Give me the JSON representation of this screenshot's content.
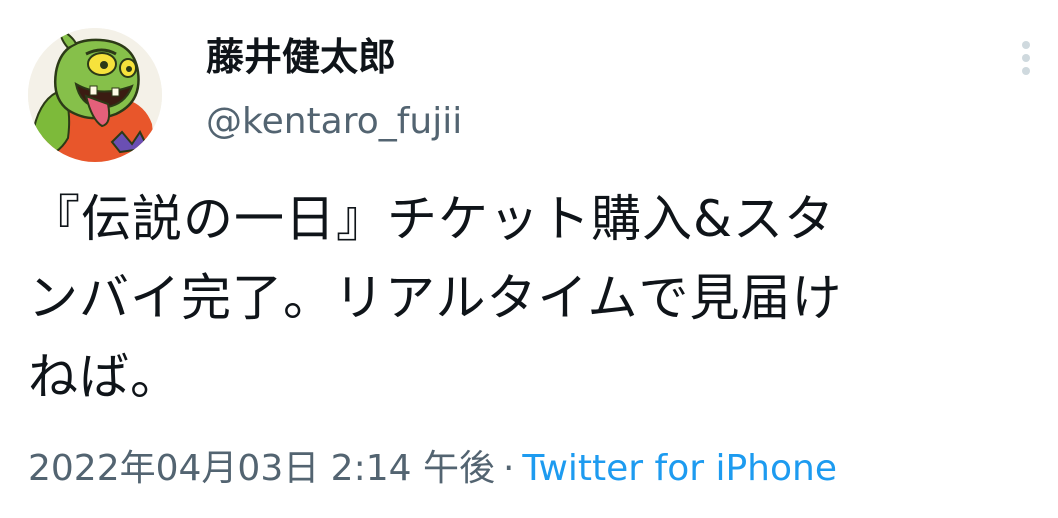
{
  "user": {
    "display_name": "藤井健太郎",
    "handle": "@kentaro_fujii",
    "avatar_icon": "green-monster-avatar"
  },
  "menu": {
    "icon": "more-vertical-icon"
  },
  "tweet": {
    "lines": [
      "『伝説の一日』チケット購入&スタ",
      "ンバイ完了。リアルタイムで見届け",
      "ねば。"
    ]
  },
  "meta": {
    "timestamp": "2022年04月03日 2:14 午後",
    "separator": "·",
    "source": "Twitter for iPhone"
  },
  "colors": {
    "text_primary": "#0f1419",
    "text_secondary": "#536471",
    "link": "#1d9bf0"
  }
}
